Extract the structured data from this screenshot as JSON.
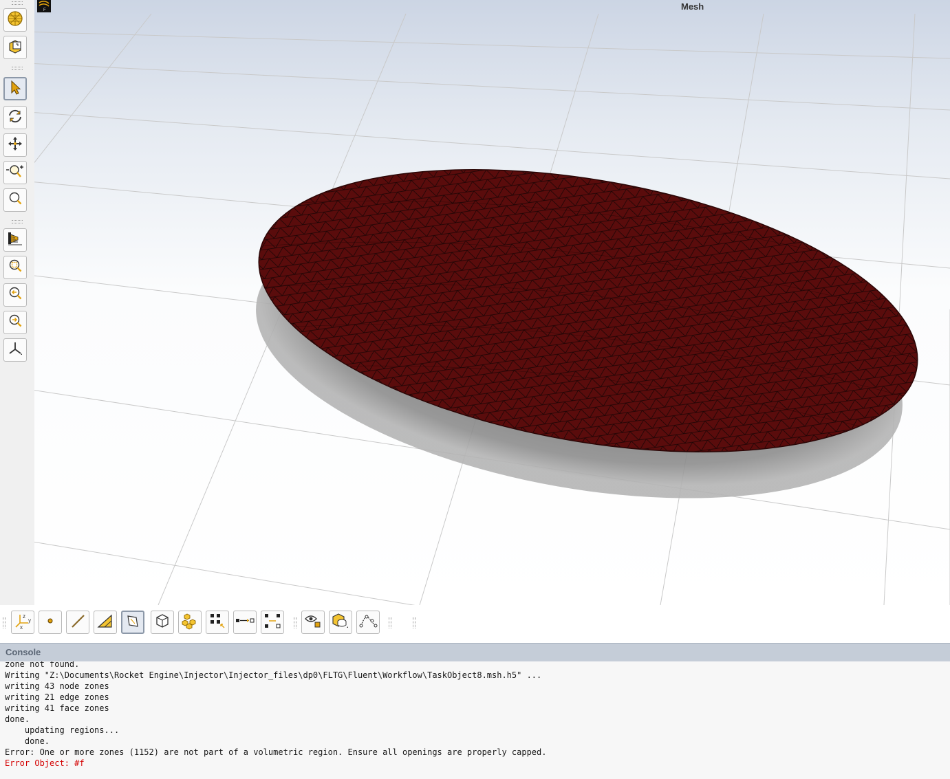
{
  "viewport": {
    "title": "Mesh",
    "colors": {
      "mesh_fill": "#5a0c0c",
      "mesh_lines": "#1a0505",
      "shadow": "#8d8d8d",
      "grid": "#c9c9c9"
    }
  },
  "left_toolbar": {
    "buttons": [
      {
        "icon": "mesh-display-icon"
      },
      {
        "icon": "clip-plane-icon"
      },
      {
        "icon": "select-pointer-icon",
        "active": true
      },
      {
        "icon": "rotate-icon"
      },
      {
        "icon": "pan-icon"
      },
      {
        "icon": "zoom-in-out-icon"
      },
      {
        "icon": "zoom-box-icon"
      },
      {
        "icon": "view-options-icon"
      },
      {
        "icon": "fit-to-window-icon"
      },
      {
        "icon": "previous-view-icon"
      },
      {
        "icon": "next-view-icon"
      },
      {
        "icon": "axes-triad-icon"
      }
    ]
  },
  "bottom_toolbar": {
    "buttons": [
      {
        "icon": "xyz-coordinates-icon"
      },
      {
        "icon": "select-point-icon"
      },
      {
        "icon": "select-edge-icon"
      },
      {
        "icon": "select-face-triangle-icon"
      },
      {
        "icon": "select-face-icon",
        "active": true
      },
      {
        "icon": "select-body-icon"
      },
      {
        "icon": "select-objects-icon"
      },
      {
        "icon": "select-zones-icon"
      },
      {
        "icon": "select-node-to-node-icon"
      },
      {
        "icon": "select-node-edge-icon"
      },
      {
        "icon": "show-hide-icon"
      },
      {
        "icon": "display-bodies-icon"
      },
      {
        "icon": "curve-points-icon"
      }
    ]
  },
  "console": {
    "title": "Console",
    "lines": [
      {
        "text": "zone not found.",
        "error": false
      },
      {
        "text": "Writing \"Z:\\Documents\\Rocket Engine\\Injector\\Injector_files\\dp0\\FLTG\\Fluent\\Workflow\\TaskObject8.msh.h5\" ...",
        "error": false
      },
      {
        "text": "writing 43 node zones",
        "error": false
      },
      {
        "text": "writing 21 edge zones",
        "error": false
      },
      {
        "text": "writing 41 face zones",
        "error": false
      },
      {
        "text": "done.",
        "error": false
      },
      {
        "text": "    updating regions...",
        "error": false
      },
      {
        "text": "    done.",
        "error": false
      },
      {
        "text": "Error: One or more zones (1152) are not part of a volumetric region. Ensure all openings are properly capped.",
        "error": false
      },
      {
        "text": "Error Object: #f",
        "error": true
      }
    ]
  }
}
